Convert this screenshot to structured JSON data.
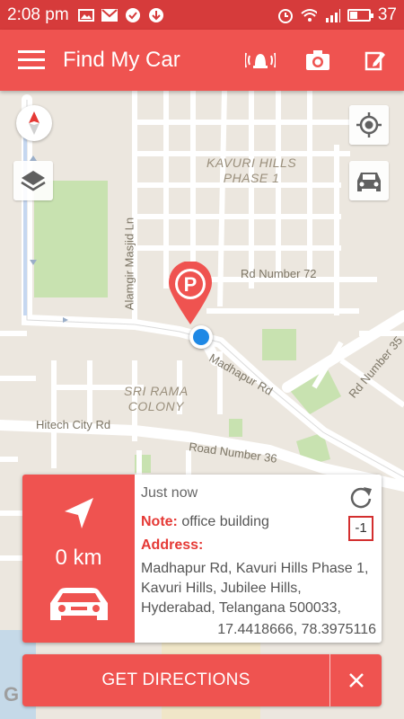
{
  "status_bar": {
    "time": "2:08 pm",
    "battery": "37"
  },
  "app_bar": {
    "title": "Find My Car"
  },
  "map": {
    "roads": [
      {
        "label": "Alamgir Masjid Ln"
      },
      {
        "label": "Rd Number 72"
      },
      {
        "label": "Madhapur Rd"
      },
      {
        "label": "Rd Number 35"
      },
      {
        "label": "Hitech City Rd"
      },
      {
        "label": "Road Number 36"
      }
    ],
    "areas": [
      {
        "label": "KAVURI HILLS\nPHASE 1"
      },
      {
        "label": "SRI RAMA\nCOLONY"
      }
    ]
  },
  "card": {
    "distance": "0 km",
    "time": "Just now",
    "note_label": "Note:",
    "note_value": "office building",
    "address_label": "Address:",
    "address": "Madhapur Rd, Kavuri Hills Phase 1, Kavuri Hills, Jubilee Hills, Hyderabad, Telangana 500033,",
    "coordinates": "17.4418666, 78.3975116",
    "counter": "-1"
  },
  "actions": {
    "get_directions": "GET DIRECTIONS"
  },
  "colors": {
    "primary": "#ef5350",
    "status_bar": "#d63b3b",
    "accent_text": "#e53935",
    "location_dot": "#1e88e5"
  }
}
